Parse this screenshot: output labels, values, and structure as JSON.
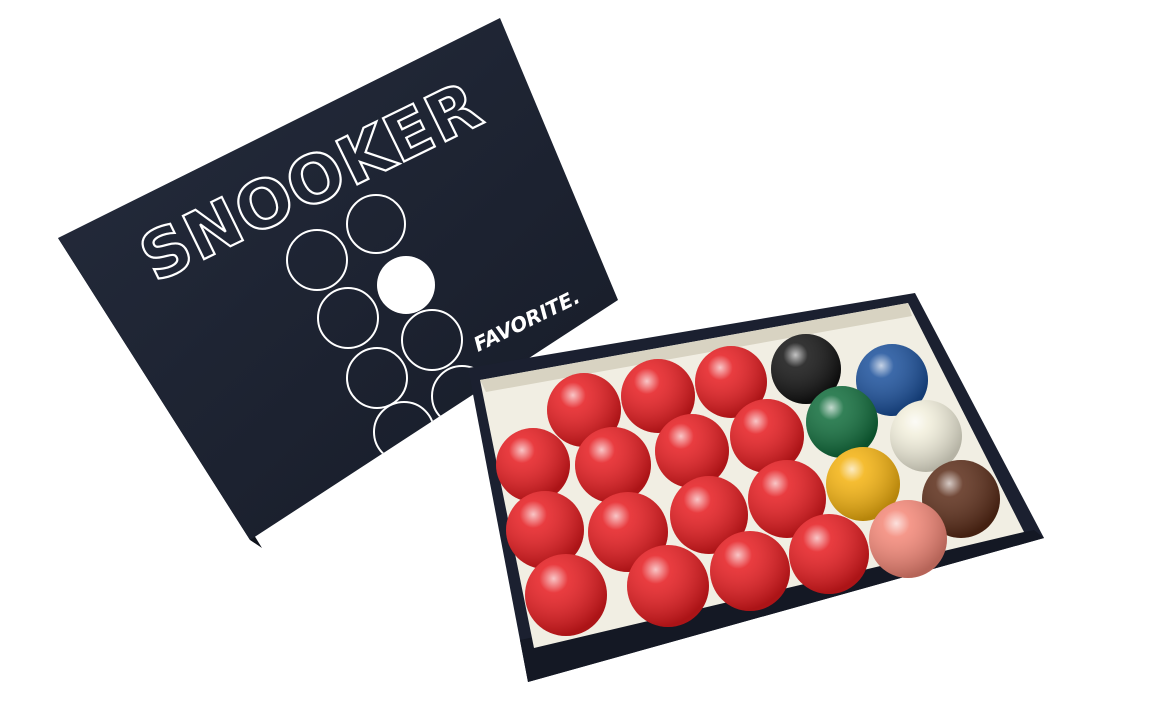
{
  "lid": {
    "title": "SNOOKER",
    "brand": "FAVORITE."
  },
  "colors": {
    "background": "#ffffff",
    "box": "#1e2433",
    "tray_liner": "#f1eee3",
    "red": "#e51a1e",
    "black": "#111111",
    "blue": "#1a4f9a",
    "green": "#0f6b3a",
    "white": "#f2efdc",
    "yellow": "#f3b10e",
    "brown": "#5a2b17",
    "pink": "#f38676"
  },
  "balls": {
    "red_count": 15,
    "colored": [
      "black",
      "blue",
      "green",
      "white",
      "yellow",
      "brown",
      "pink"
    ]
  }
}
